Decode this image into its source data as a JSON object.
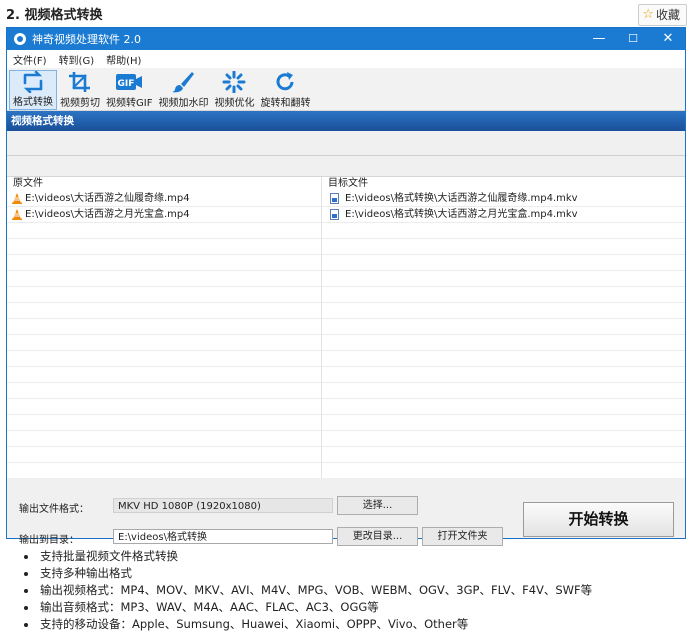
{
  "page": {
    "heading": "2. 视频格式转换",
    "favorite_label": "收藏"
  },
  "window": {
    "title": "神奇视频处理软件 2.0",
    "controls": {
      "minimize": "—",
      "maximize": "☐",
      "close": "✕"
    }
  },
  "menu": {
    "items": [
      "文件(F)",
      "转到(G)",
      "帮助(H)"
    ]
  },
  "toolbar": {
    "items": [
      {
        "label": "格式转换",
        "icon": "format-convert-icon",
        "active": true
      },
      {
        "label": "视频剪切",
        "icon": "crop-icon",
        "active": false
      },
      {
        "label": "视频转GIF",
        "icon": "gif-icon",
        "active": false
      },
      {
        "label": "视频加水印",
        "icon": "brush-icon",
        "active": false
      },
      {
        "label": "视频优化",
        "icon": "optimize-icon",
        "active": false
      },
      {
        "label": "旋转和翻转",
        "icon": "rotate-icon",
        "active": false
      }
    ],
    "accent_color": "#1b7bd2"
  },
  "section": {
    "title": "视频格式转换"
  },
  "files": {
    "source_header": "原文件",
    "target_header": "目标文件",
    "source": [
      "E:\\videos\\大话西游之仙履奇缘.mp4",
      "E:\\videos\\大话西游之月光宝盒.mp4"
    ],
    "target": [
      "E:\\videos\\格式转换\\大话西游之仙履奇缘.mp4.mkv",
      "E:\\videos\\格式转换\\大话西游之月光宝盒.mp4.mkv"
    ]
  },
  "output": {
    "format_label": "输出文件格式：",
    "format_value": "MKV HD 1080P (1920x1080)",
    "select_button": "选择...",
    "dir_label": "输出到目录：",
    "dir_value": "E:\\videos\\格式转换",
    "change_dir_button": "更改目录...",
    "open_folder_button": "打开文件夹",
    "start_button": "开始转换"
  },
  "features": [
    "支持批量视频文件格式转换",
    "支持多种输出格式",
    "输出视频格式：MP4、MOV、MKV、AVI、M4V、MPG、VOB、WEBM、OGV、3GP、FLV、F4V、SWF等",
    "输出音频格式：MP3、WAV、M4A、AAC、FLAC、AC3、OGG等",
    "支持的移动设备：Apple、Sumsung、Huawei、Xiaomi、OPPP、Vivo、Other等"
  ]
}
